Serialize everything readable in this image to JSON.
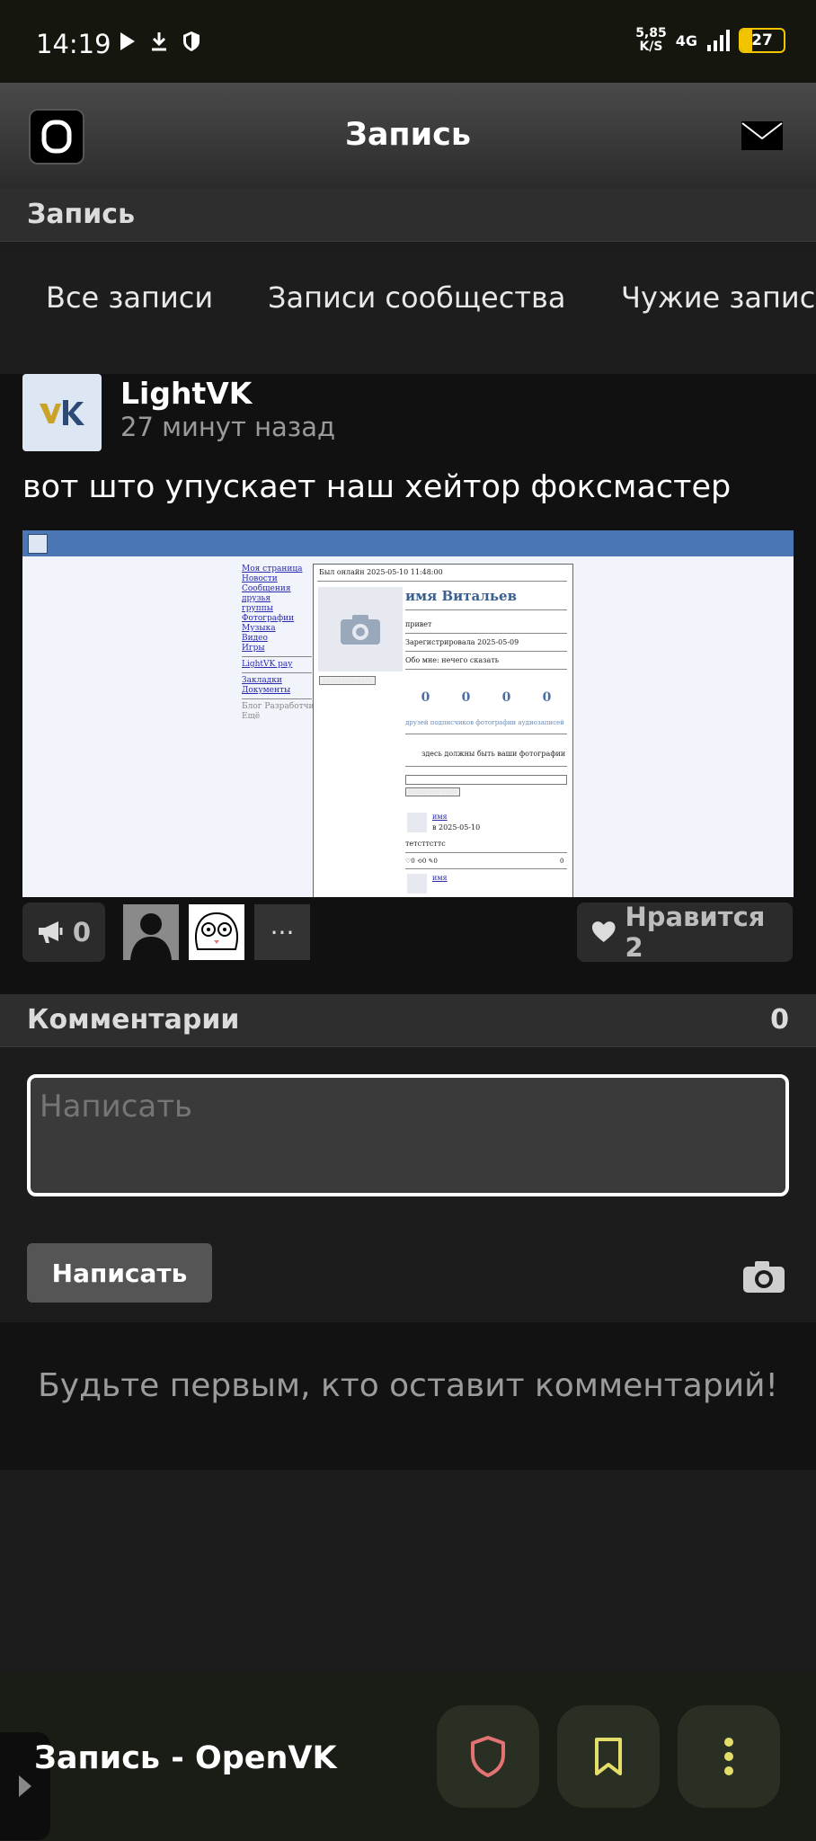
{
  "status_bar": {
    "time": "14:19",
    "speed_value": "5,85",
    "speed_unit": "K/S",
    "network": "4G",
    "battery": "27",
    "battery_level": 0.27
  },
  "app_bar": {
    "title": "Запись"
  },
  "section": {
    "title": "Запись"
  },
  "tabs": [
    "Все записи",
    "Записи сообщества",
    "Чужие записи"
  ],
  "post": {
    "author": "LightVK",
    "time": "27 минут назад",
    "text": "вот што упускает наш хейтор фоксмастер",
    "shot": {
      "nav": [
        "Моя страница",
        "Новости",
        "Сообщения",
        "друзья",
        "группы",
        "Фотографии",
        "Музыка",
        "Видео",
        "Игры"
      ],
      "nav2": [
        "LightVK pay"
      ],
      "nav3": [
        "Закладки",
        "Документы"
      ],
      "nav4": [
        "Блог Разработчиков",
        "Ещё"
      ],
      "online": "Был онлайн 2025-05-10 11:48:00",
      "name": "имя Витальев",
      "status": "привет",
      "registered": "Зарегистрировала 2025-05-09",
      "about": "Обо мне: нечего сказать",
      "counts": [
        "0",
        "0",
        "0",
        "0"
      ],
      "count_labels": "друзей подписчиков фотографии аудиозаписей",
      "empty_photos": "здесь должны быть ваши фотографии",
      "edit_btn": "редактировать",
      "write_btn": "написать пост",
      "wall_author": "имя",
      "wall_date": "в 2025-05-10",
      "wall_text": "тетсттсттс",
      "wall_stats": "♡0 ⟲0 ✎0",
      "wall_right": "0",
      "wall_author2": "имя"
    }
  },
  "actions": {
    "repost_count": "0",
    "more": "···",
    "like_label": "Нравится 2"
  },
  "comments": {
    "title": "Комментарии",
    "count": "0",
    "placeholder": "Написать",
    "submit": "Написать",
    "empty": "Будьте первым, кто оставит комментарий!"
  },
  "bottom": {
    "page_title": "Запись - OpenVK"
  },
  "icons": {
    "status": [
      "play-icon",
      "download-icon",
      "shield-icon"
    ],
    "appbar": [
      "openvk-logo-icon",
      "mail-icon"
    ],
    "actions": [
      "megaphone-icon",
      "heart-icon"
    ],
    "comments": [
      "camera-icon"
    ],
    "bottom": [
      "shield-icon",
      "bookmark-icon",
      "more-vertical-icon"
    ]
  },
  "colors": {
    "accent_yellow": "#f2c400",
    "shield_red": "#e57373",
    "bookmark_yellow": "#e3dd6a",
    "vk_blue": "#4a76b3"
  }
}
